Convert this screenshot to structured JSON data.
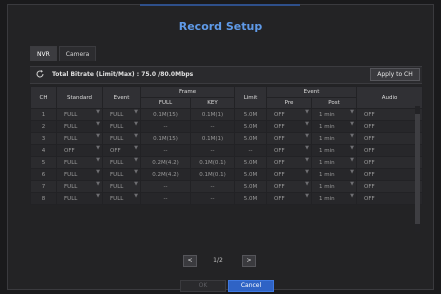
{
  "dialog": {
    "title": "Record Setup"
  },
  "tabs": [
    {
      "label": "NVR",
      "active": true
    },
    {
      "label": "Camera",
      "active": false
    }
  ],
  "toolbar": {
    "bitrate_text": "Total Bitrate (Limit/Max) : 75.0 /80.0Mbps",
    "apply_label": "Apply to CH",
    "refresh_icon": "refresh-icon"
  },
  "table": {
    "headers": {
      "ch": "CH",
      "standard": "Standard",
      "event": "Event",
      "frame": "Frame",
      "full": "FULL",
      "key": "KEY",
      "limit": "Limit",
      "event_group": "Event",
      "pre": "Pre",
      "post": "Post",
      "audio": "Audio"
    },
    "rows": [
      {
        "ch": "1",
        "standard": "FULL",
        "event": "FULL",
        "full": "0.1M(15)",
        "key": "0.1M(1)",
        "limit": "5.0M",
        "pre": "OFF",
        "post": "1 min",
        "audio": "OFF"
      },
      {
        "ch": "2",
        "standard": "FULL",
        "event": "FULL",
        "full": "--",
        "key": "--",
        "limit": "5.0M",
        "pre": "OFF",
        "post": "1 min",
        "audio": "OFF"
      },
      {
        "ch": "3",
        "standard": "FULL",
        "event": "FULL",
        "full": "0.1M(15)",
        "key": "0.1M(1)",
        "limit": "5.0M",
        "pre": "OFF",
        "post": "1 min",
        "audio": "OFF"
      },
      {
        "ch": "4",
        "standard": "OFF",
        "event": "OFF",
        "full": "--",
        "key": "--",
        "limit": "--",
        "pre": "OFF",
        "post": "1 min",
        "audio": "OFF"
      },
      {
        "ch": "5",
        "standard": "FULL",
        "event": "FULL",
        "full": "0.2M(4.2)",
        "key": "0.1M(0.1)",
        "limit": "5.0M",
        "pre": "OFF",
        "post": "1 min",
        "audio": "OFF"
      },
      {
        "ch": "6",
        "standard": "FULL",
        "event": "FULL",
        "full": "0.2M(4.2)",
        "key": "0.1M(0.1)",
        "limit": "5.0M",
        "pre": "OFF",
        "post": "1 min",
        "audio": "OFF"
      },
      {
        "ch": "7",
        "standard": "FULL",
        "event": "FULL",
        "full": "--",
        "key": "--",
        "limit": "5.0M",
        "pre": "OFF",
        "post": "1 min",
        "audio": "OFF"
      },
      {
        "ch": "8",
        "standard": "FULL",
        "event": "FULL",
        "full": "--",
        "key": "--",
        "limit": "5.0M",
        "pre": "OFF",
        "post": "1 min",
        "audio": "OFF"
      }
    ]
  },
  "pager": {
    "prev": "<",
    "page": "1/2",
    "next": ">"
  },
  "footer": {
    "ok": "OK",
    "cancel": "Cancel"
  },
  "colors": {
    "accent": "#2f63c5",
    "title": "#5f9ae8",
    "background": "#1a1a1c"
  }
}
